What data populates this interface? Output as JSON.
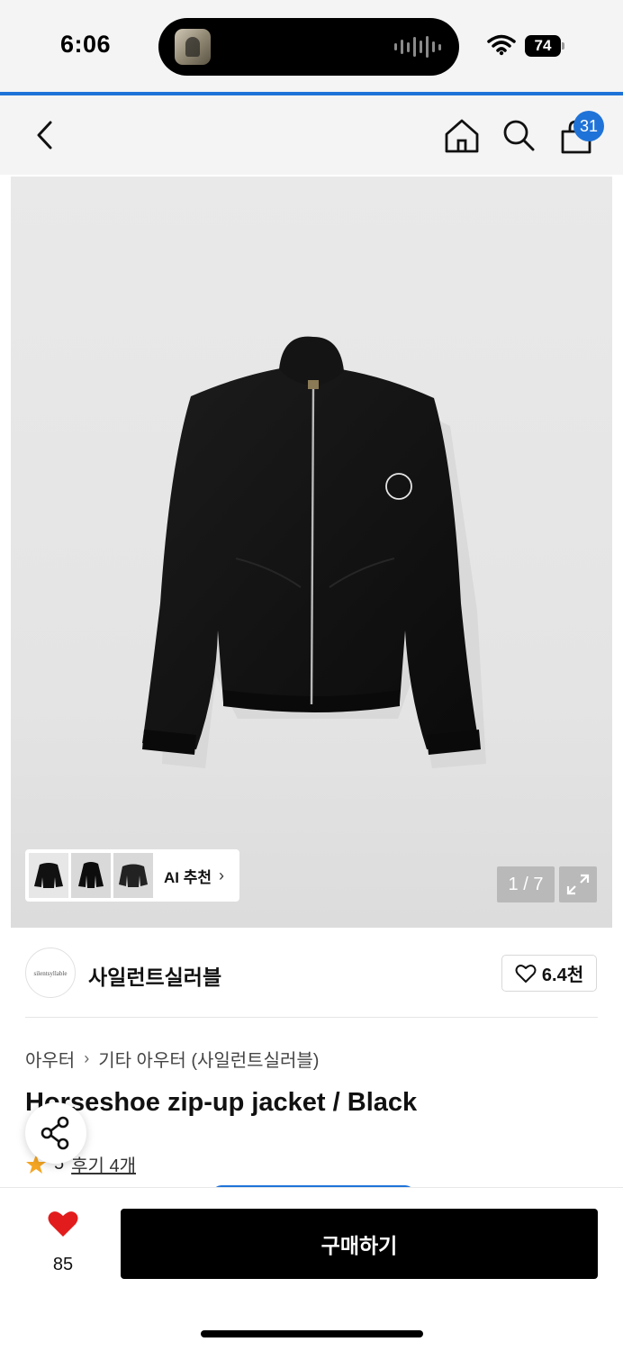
{
  "status_bar": {
    "time": "6:06",
    "battery": "74",
    "icons": [
      "wifi-icon",
      "battery-icon",
      "waveform-icon"
    ]
  },
  "nav": {
    "icons": [
      "back-icon",
      "home-icon",
      "search-icon",
      "shopping-bag-icon"
    ],
    "cart_count": "31"
  },
  "gallery": {
    "ai_label": "AI 추천",
    "counter": "1 / 7"
  },
  "brand": {
    "logo_text": "silentsyllable",
    "name": "사일런트실러블",
    "likes": "6.4천"
  },
  "product": {
    "breadcrumb": [
      "아우터",
      "기타 아우터 (사일런트실러블)"
    ],
    "title": "Horseshoe zip-up jacket / Black",
    "rating": "5",
    "review_link": "후기 4개"
  },
  "bottom": {
    "wish_count": "85",
    "buy_label": "구매하기"
  },
  "colors": {
    "accent": "#1f73d8",
    "wish": "#e21c1c",
    "star": "#f5a623"
  }
}
